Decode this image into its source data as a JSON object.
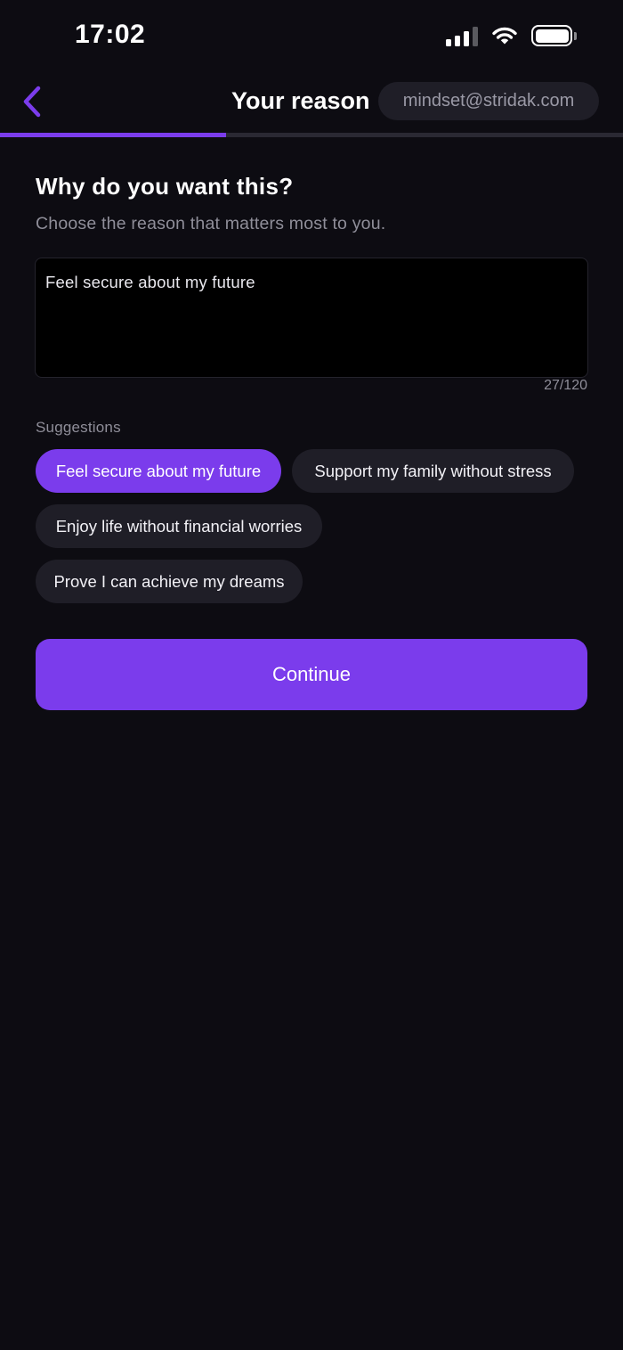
{
  "status_bar": {
    "time": "17:02",
    "icons": [
      "signal-icon",
      "wifi-icon",
      "battery-icon"
    ]
  },
  "header": {
    "back_icon": "chevron-left-icon",
    "title": "Your reason",
    "email": "mindset@stridak.com",
    "progress_fraction": 0.363
  },
  "question": {
    "title": "Why do you want this?",
    "subtitle": "Choose the reason that matters most to you."
  },
  "reason_input": {
    "value": "Feel secure about my future",
    "counter": "27/120"
  },
  "suggestions": {
    "label": "Suggestions",
    "items": [
      {
        "label": "Feel secure about my future",
        "selected": true
      },
      {
        "label": "Support my family without stress",
        "selected": false
      },
      {
        "label": "Enjoy life without financial worries",
        "selected": false
      },
      {
        "label": "Prove I can achieve my dreams",
        "selected": false
      }
    ]
  },
  "continue_label": "Continue",
  "colors": {
    "background": "#0d0c12",
    "accent": "#7b3cec",
    "chip": "#1f1e27",
    "muted_text": "#8f8e99"
  }
}
